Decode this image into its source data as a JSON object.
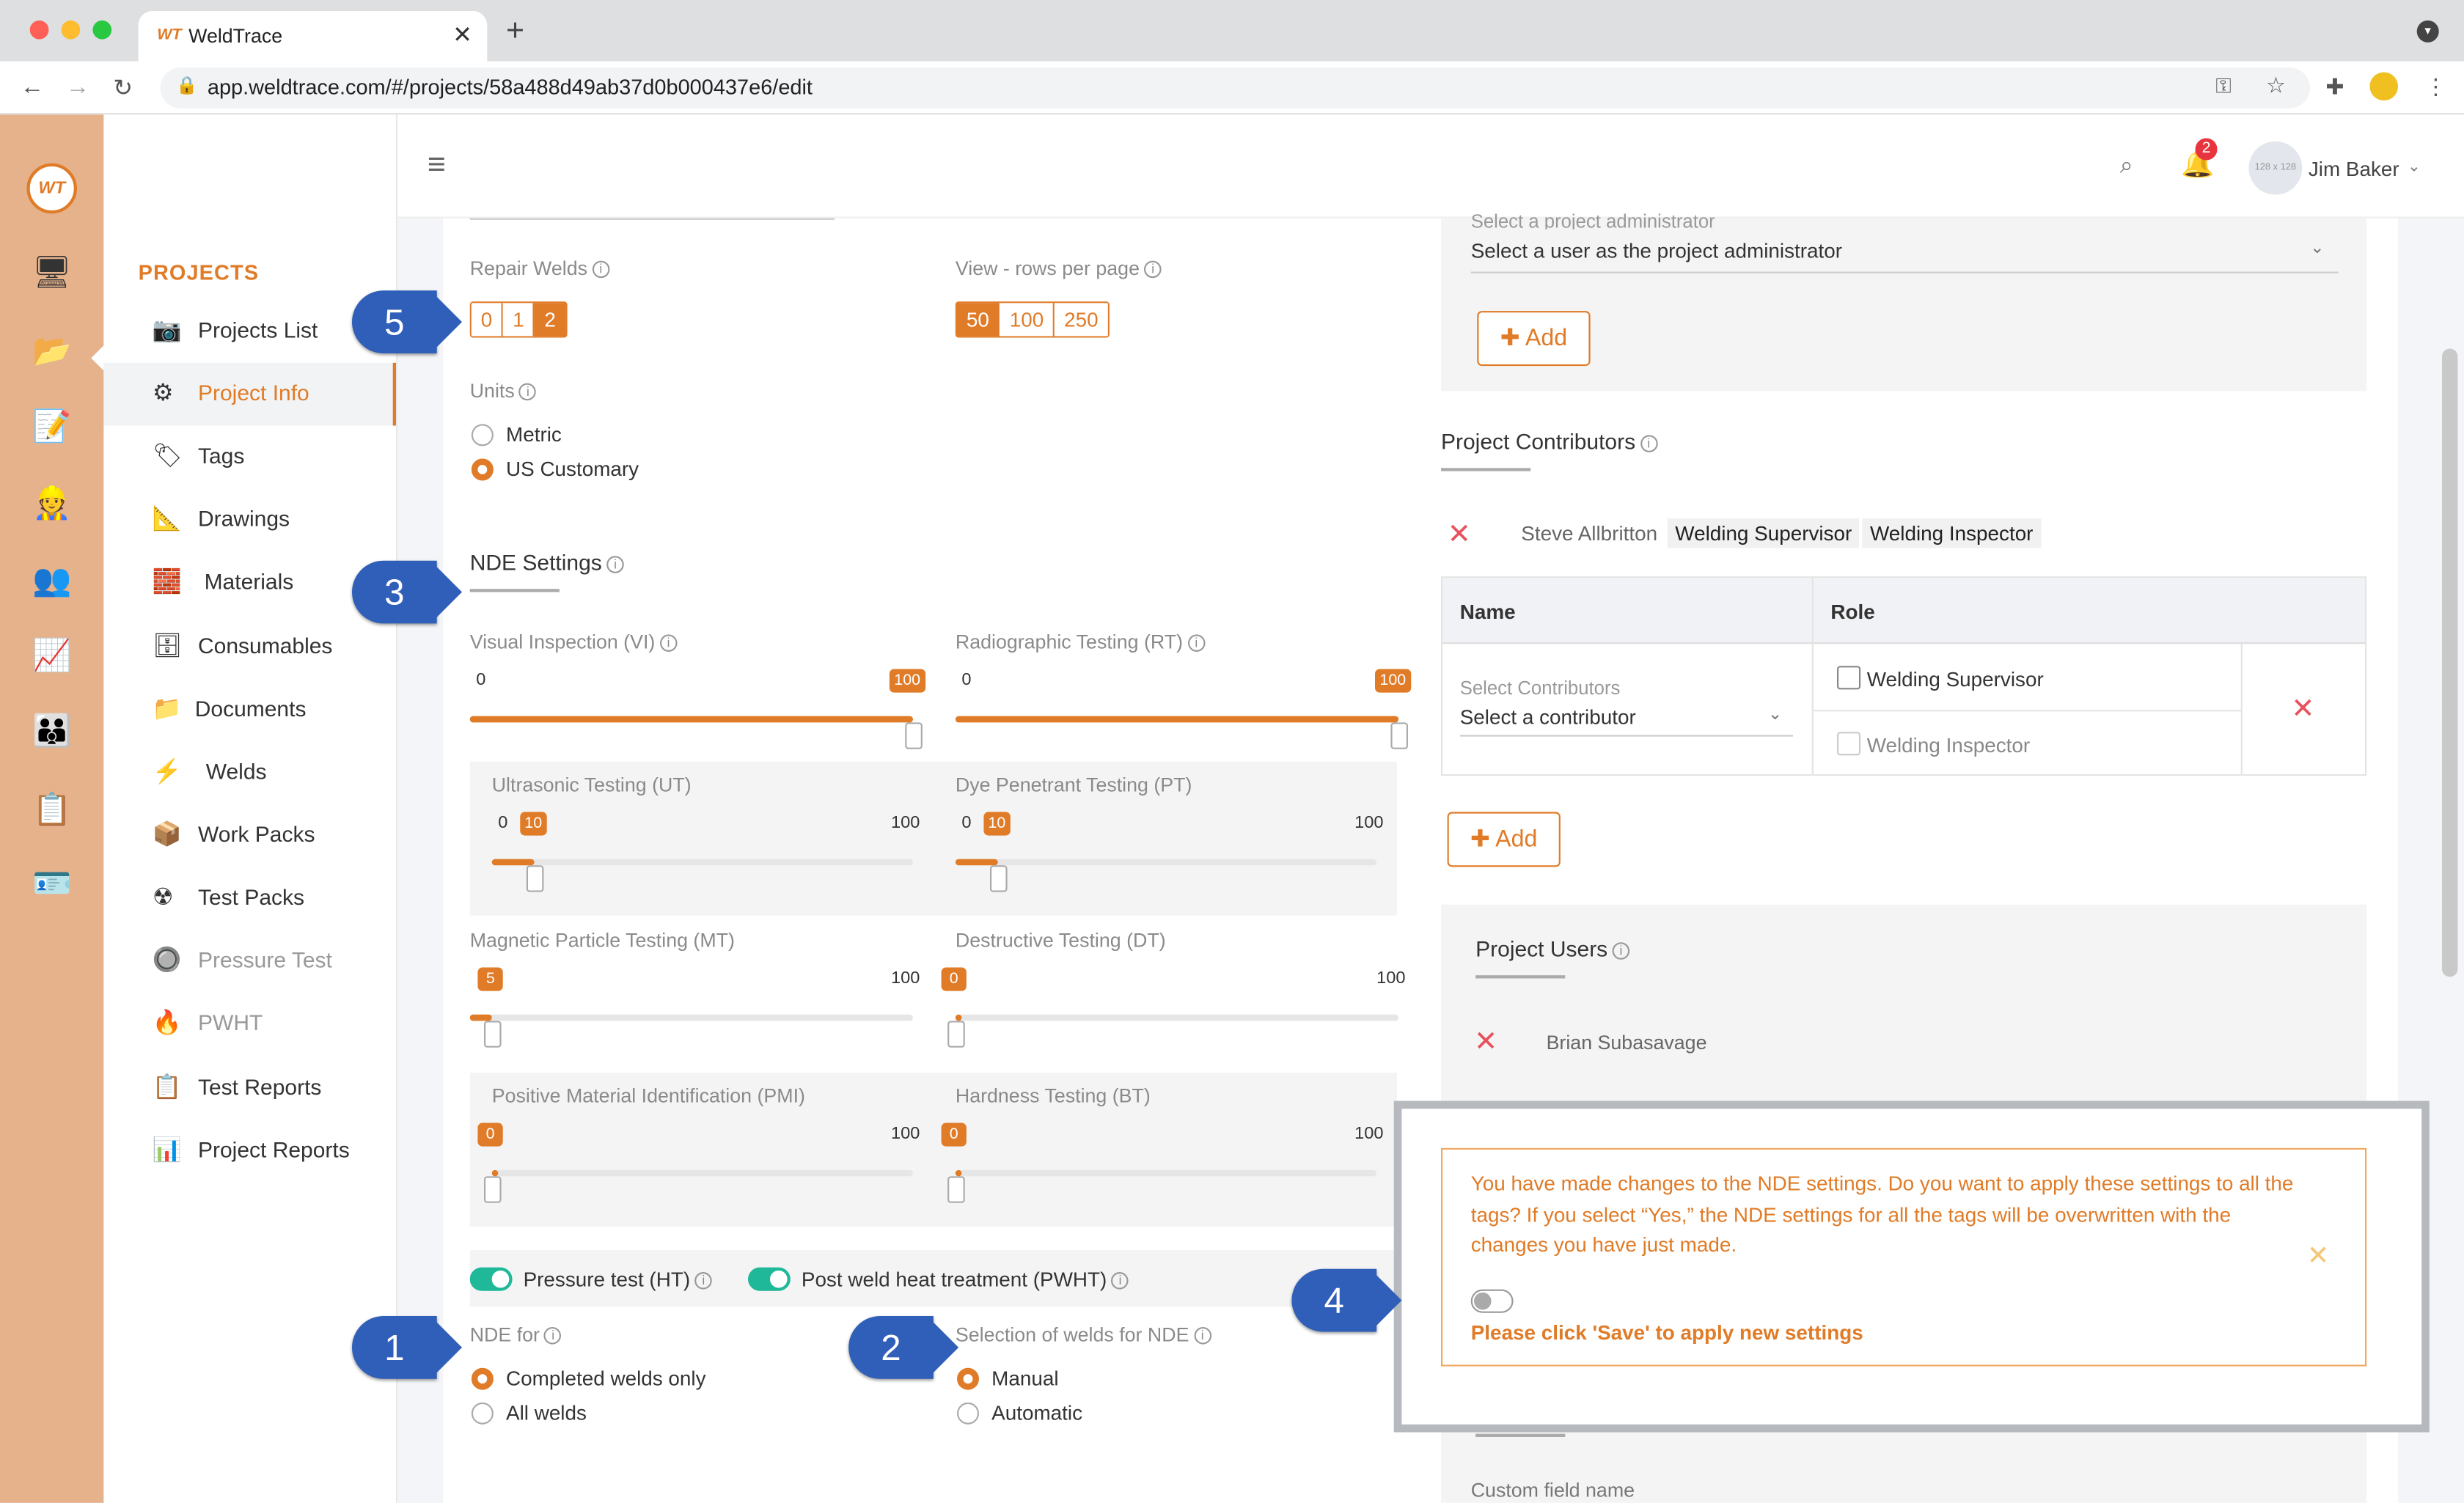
{
  "browser": {
    "tab_logo": "WT",
    "tab_title": "WeldTrace",
    "url": "app.weldtrace.com/#/projects/58a488d49ab37d0b000437e6/edit"
  },
  "sidebar": {
    "header": "PROJECTS",
    "items": [
      {
        "label": "Projects List",
        "icon": "📷"
      },
      {
        "label": "Project Info",
        "icon": "⚙"
      },
      {
        "label": "Tags",
        "icon": "🏷"
      },
      {
        "label": "Drawings",
        "icon": "📐"
      },
      {
        "label": "Materials",
        "icon": "🧱"
      },
      {
        "label": "Consumables",
        "icon": "🗄"
      },
      {
        "label": "Documents",
        "icon": "📁"
      },
      {
        "label": "Welds",
        "icon": "⚡"
      },
      {
        "label": "Work Packs",
        "icon": "📦"
      },
      {
        "label": "Test Packs",
        "icon": "☢"
      },
      {
        "label": "Pressure Test",
        "icon": "🔘"
      },
      {
        "label": "PWHT",
        "icon": "🔥"
      },
      {
        "label": "Test Reports",
        "icon": "📋"
      },
      {
        "label": "Project Reports",
        "icon": "📊"
      }
    ]
  },
  "topbar": {
    "notification_count": "2",
    "avatar_text": "128 x 128",
    "user_name": "Jim Baker"
  },
  "settings": {
    "repair_welds_label": "Repair Welds",
    "repair_welds_options": [
      "0",
      "1",
      "2"
    ],
    "repair_welds_selected": "2",
    "rows_label": "View - rows per page",
    "rows_options": [
      "50",
      "100",
      "250"
    ],
    "rows_selected": "50",
    "units_label": "Units",
    "units_options": [
      "Metric",
      "US Customary"
    ],
    "units_selected": "US Customary"
  },
  "nde": {
    "title": "NDE Settings",
    "tests": [
      {
        "name": "Visual Inspection (VI)",
        "value": 100,
        "min": "0",
        "max": "100"
      },
      {
        "name": "Radiographic Testing (RT)",
        "value": 100,
        "min": "0",
        "max": "100"
      },
      {
        "name": "Ultrasonic Testing (UT)",
        "value": 10,
        "min": "0",
        "max": "100"
      },
      {
        "name": "Dye Penetrant Testing (PT)",
        "value": 10,
        "min": "0",
        "max": "100"
      },
      {
        "name": "Magnetic Particle Testing (MT)",
        "value": 5,
        "min": "0",
        "max": "100"
      },
      {
        "name": "Destructive Testing (DT)",
        "value": 0,
        "min": "0",
        "max": "100"
      },
      {
        "name": "Positive Material Identification (PMI)",
        "value": 0,
        "min": "0",
        "max": "100"
      },
      {
        "name": "Hardness Testing (BT)",
        "value": 0,
        "min": "0",
        "max": "100"
      }
    ],
    "pressure_toggle": "Pressure test (HT)",
    "pwht_toggle": "Post weld heat treatment (PWHT)",
    "nde_for_label": "NDE for",
    "nde_for_options": [
      "Completed welds only",
      "All welds"
    ],
    "selection_label": "Selection of welds for NDE",
    "selection_options": [
      "Manual",
      "Automatic"
    ]
  },
  "right": {
    "admin_label": "Select a project administrator",
    "admin_value": "Select a user as the project administrator",
    "add_label": "Add",
    "contributors_title": "Project Contributors",
    "contributor_name": "Steve Allbritton",
    "contributor_roles": [
      "Welding Supervisor",
      "Welding Inspector"
    ],
    "table_name_col": "Name",
    "table_role_col": "Role",
    "select_contrib_label": "Select Contributors",
    "select_contrib_value": "Select a contributor",
    "role_options": [
      "Welding Supervisor",
      "Welding Inspector"
    ],
    "users_title": "Project Users",
    "user_name": "Brian Subasavage",
    "custom_field_label": "Custom field name"
  },
  "alert": {
    "message": "You have made changes to the NDE settings. Do you want to apply these settings to all the tags? If you select “Yes,” the NDE settings for all the tags will be overwritten with the changes you have just made.",
    "save_note": "Please click 'Save' to apply new settings"
  },
  "callouts": [
    "1",
    "2",
    "3",
    "4",
    "5"
  ],
  "colors": {
    "accent": "#e07b27",
    "callout": "#2f5fb8",
    "toggle_on": "#1fb99a",
    "danger": "#e8525e"
  }
}
